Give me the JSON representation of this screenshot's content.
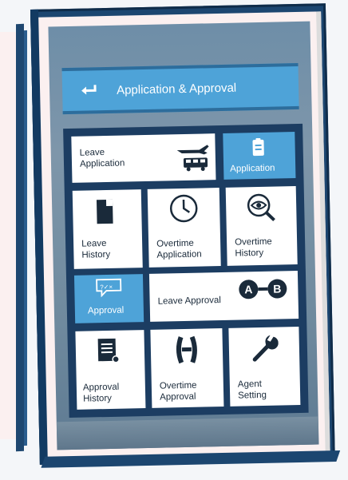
{
  "header": {
    "title": "Application & Approval",
    "back_icon": "return-arrow-icon"
  },
  "tiles": {
    "leave_application": {
      "line1": "Leave",
      "line2": "Application",
      "icon": "plane-bus-icon"
    },
    "application": {
      "label": "Application",
      "icon": "clipboard-icon"
    },
    "leave_history": {
      "line1": "Leave",
      "line2": "History",
      "icon": "document-icon"
    },
    "overtime_application": {
      "line1": "Overtime",
      "line2": "Application",
      "icon": "clock-icon"
    },
    "overtime_history": {
      "line1": "Overtime",
      "line2": "History",
      "icon": "magnifier-eye-icon"
    },
    "approval": {
      "label": "Approval",
      "badge": "?✓×",
      "icon": "speech-bubble-icon"
    },
    "leave_approval": {
      "label": "Leave Approval",
      "icon": "a-to-b-icon",
      "a": "A",
      "b": "B"
    },
    "approval_history": {
      "line1": "Approval",
      "line2": "History",
      "icon": "document-pen-icon"
    },
    "overtime_approval": {
      "line1": "Overtime",
      "line2": "Approval",
      "icon": "handshake-icon"
    },
    "agent_setting": {
      "line1": "Agent",
      "line2": "Setting",
      "icon": "wrench-icon"
    }
  },
  "colors": {
    "accent": "#4ea3d8",
    "frame": "#1c3d62",
    "book": "#1c4670"
  }
}
